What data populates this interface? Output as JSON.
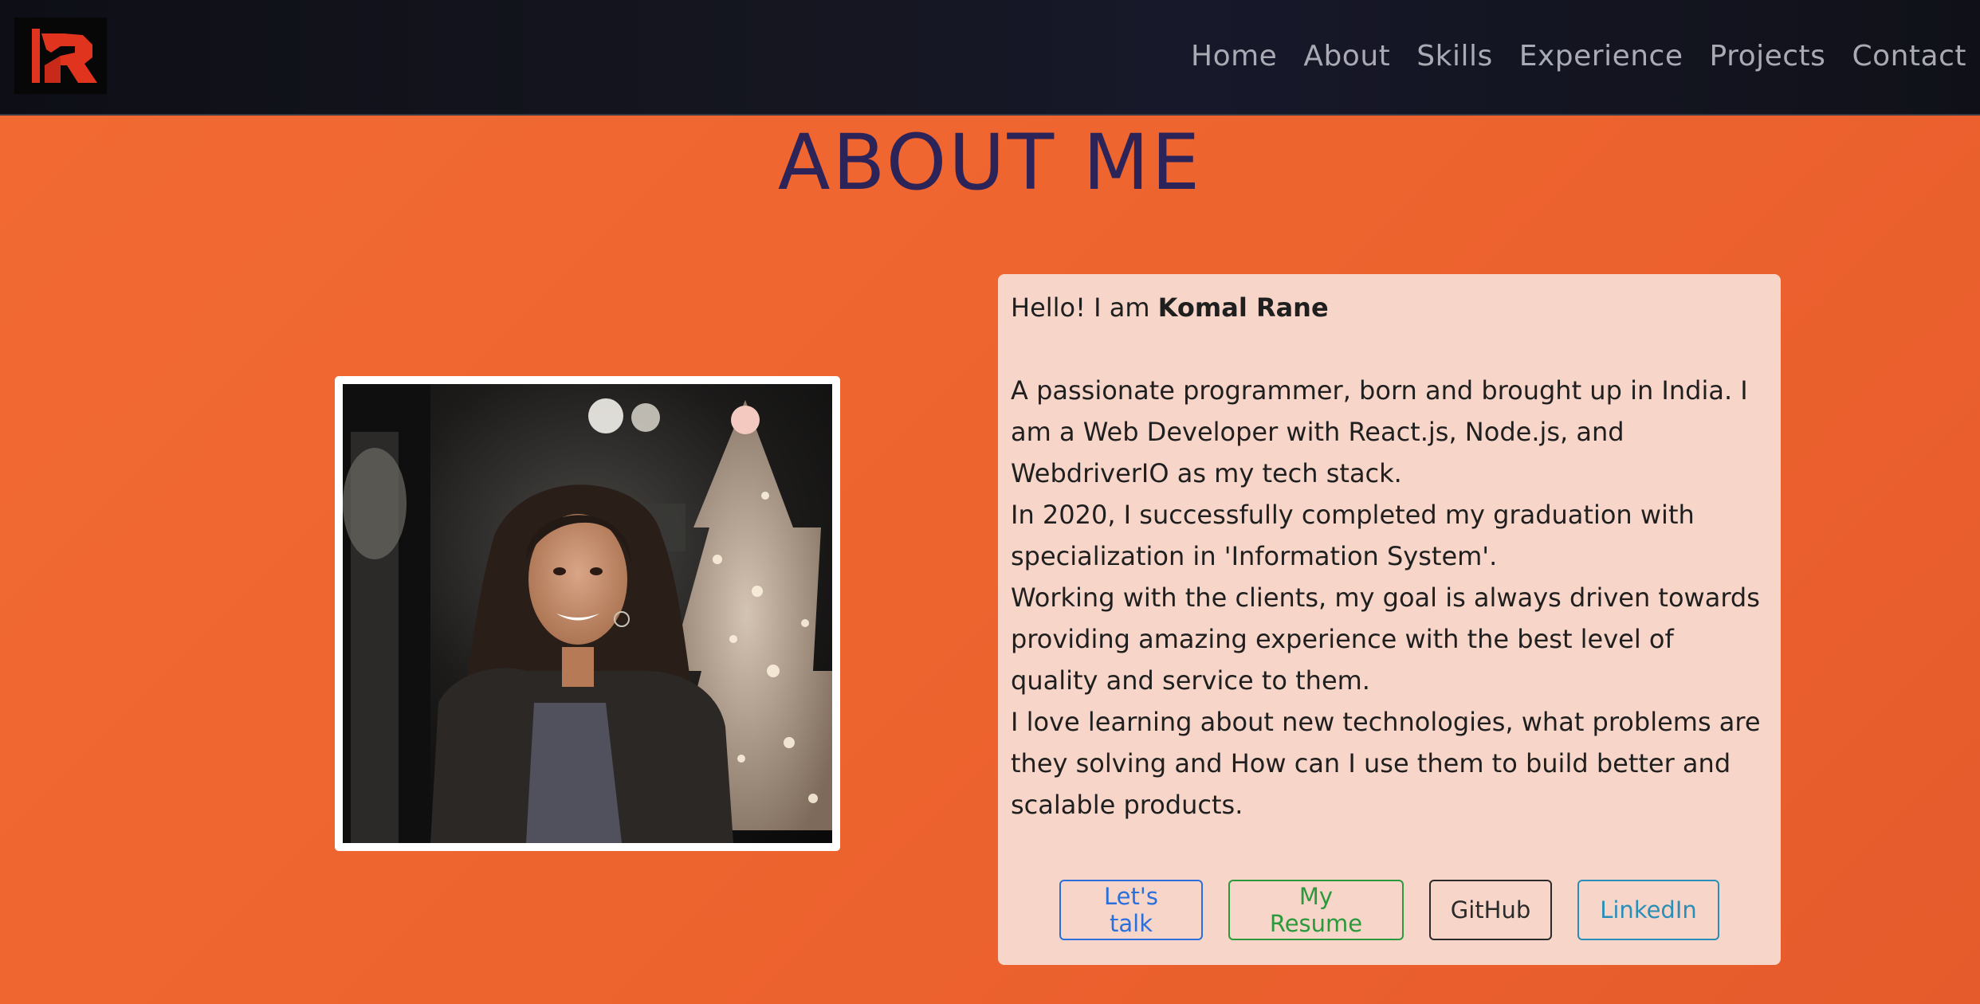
{
  "nav": {
    "logo_text": "KR",
    "links": [
      "Home",
      "About",
      "Skills",
      "Experience",
      "Projects",
      "Contact"
    ]
  },
  "about": {
    "title": "ABOUT ME",
    "greeting_prefix": "Hello! I am ",
    "name": "Komal Rane",
    "paragraphs": [
      "A passionate programmer, born and brought up in India. I am a Web Developer with React.js, Node.js, and WebdriverIO as my tech stack.",
      "In 2020, I successfully completed my graduation with specialization in 'Information System'.",
      "Working with the clients, my goal is always driven towards providing amazing experience with the best level of quality and service to them.",
      "I love learning about new technologies, what problems are they solving and How can I use them to build better and scalable products."
    ],
    "buttons": {
      "talk": "Let's talk",
      "resume": "My Resume",
      "github": "GitHub",
      "linkedin": "LinkedIn"
    }
  },
  "colors": {
    "nav_bg": "#12131b",
    "page_bg": "#ee642f",
    "title": "#2c2358",
    "card_bg": "#f7d5c8",
    "btn_talk": "#2a6fdb",
    "btn_resume": "#2a9a3c",
    "btn_github": "#2b2b2b",
    "btn_linkedin": "#2a8fb8"
  }
}
